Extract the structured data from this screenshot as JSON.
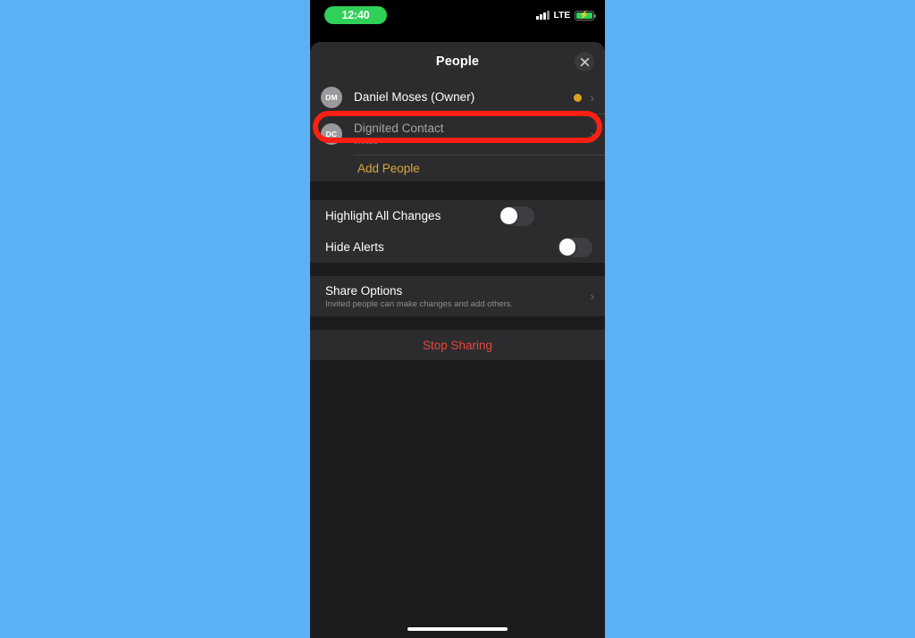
{
  "background_color": "#5CB0F5",
  "status_bar": {
    "time": "12:40",
    "time_pill_color": "#30D158",
    "carrier_network": "LTE",
    "signal_icon": "cellular-signal-icon",
    "battery_icon": "battery-charging-icon",
    "battery_color": "#30D158"
  },
  "sheet": {
    "title": "People",
    "close_label": "✕",
    "people": [
      {
        "initials": "DM",
        "name": "Daniel Moses (Owner)",
        "subtitle": "",
        "status_dot_color": "#D9A520",
        "has_status_dot": true,
        "chevron": "›",
        "muted": false
      },
      {
        "initials": "DC",
        "name": "Dignited Contact",
        "subtitle": "Invited",
        "status_dot_color": "",
        "has_status_dot": false,
        "chevron": "›",
        "muted": true
      }
    ],
    "add_people_label": "Add People",
    "add_people_color": "#D9A63C",
    "toggles": [
      {
        "label": "Highlight All Changes",
        "state": "off"
      },
      {
        "label": "Hide Alerts",
        "state": "off"
      }
    ],
    "share_options": {
      "title": "Share Options",
      "subtitle": "Invited people can make changes and add others.",
      "chevron": "›"
    },
    "stop_sharing": {
      "label": "Stop Sharing",
      "color": "#E8443A"
    }
  },
  "annotation": {
    "type": "highlight-rectangle",
    "color": "#FF1F13",
    "targets": "Dignited Contact row"
  },
  "home_indicator": "home-indicator-bar"
}
